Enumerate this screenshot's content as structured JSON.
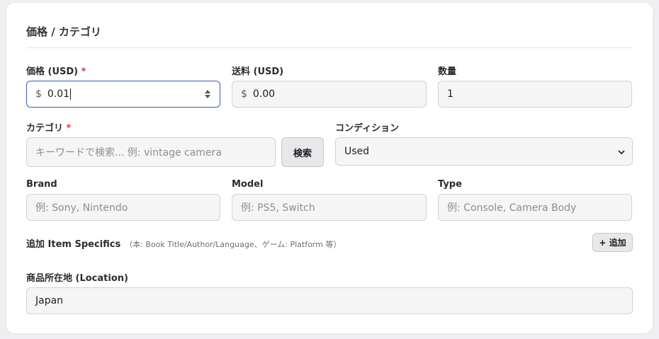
{
  "section": {
    "title": "価格 / カテゴリ"
  },
  "price": {
    "label": "価格 (USD)",
    "required": "*",
    "currency": "$",
    "value": "0.01"
  },
  "shipping": {
    "label": "送料 (USD)",
    "currency": "$",
    "value": "0.00"
  },
  "quantity": {
    "label": "数量",
    "value": "1"
  },
  "category": {
    "label": "カテゴリ",
    "required": "*",
    "placeholder": "キーワードで検索... 例: vintage camera",
    "search_button": "検索"
  },
  "condition": {
    "label": "コンディション",
    "value": "Used"
  },
  "brand": {
    "label": "Brand",
    "placeholder": "例: Sony, Nintendo"
  },
  "model": {
    "label": "Model",
    "placeholder": "例: PS5, Switch"
  },
  "type": {
    "label": "Type",
    "placeholder": "例: Console, Camera Body"
  },
  "specifics": {
    "label": "追加 Item Specifics",
    "hint": "（本: Book Title/Author/Language、ゲーム: Platform 等）",
    "add_button": "+ 追加"
  },
  "location": {
    "label": "商品所在地 (Location)",
    "value": "Japan"
  },
  "colors": {
    "focus_border": "#3b5ab5",
    "required": "#e0393e",
    "card_bg": "#ffffff",
    "page_bg": "#efeff1"
  }
}
